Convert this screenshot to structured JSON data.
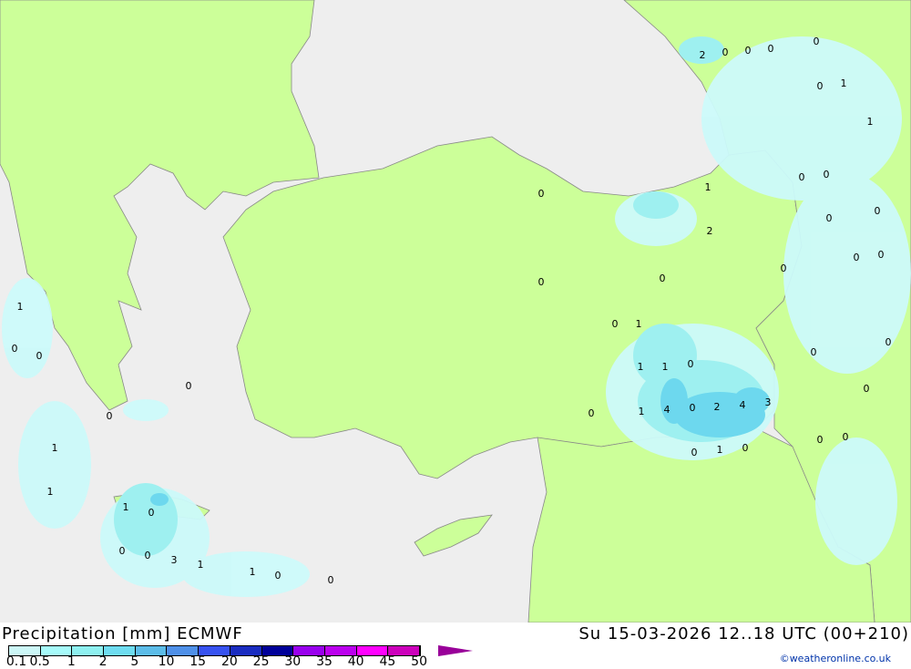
{
  "title": "Precipitation [mm] ECMWF",
  "valid_time": "Su 15-03-2026 12..18 UTC (00+210)",
  "copyright": "©weatheronline.co.uk",
  "colors": {
    "land": "#ccff99",
    "sea": "#eeeeee",
    "border": "#888888",
    "precip_light": "#ccfafa",
    "precip_mid": "#9ef0f0",
    "precip_high": "#6dd8ee"
  },
  "legend": {
    "ticks": [
      "0.1",
      "0.5",
      "1",
      "2",
      "5",
      "10",
      "15",
      "20",
      "25",
      "30",
      "35",
      "40",
      "45",
      "50"
    ],
    "colors": [
      "#ccf7f7",
      "#a6fafa",
      "#8ef0f0",
      "#6edcf0",
      "#5cbce8",
      "#4f90e8",
      "#3752f0",
      "#1a2cc0",
      "#000099",
      "#9900ee",
      "#bb00ee",
      "#ff00ff",
      "#cc00bb"
    ]
  },
  "precip_labels": [
    "2",
    "0",
    "0",
    "0",
    "0",
    "0",
    "1",
    "1",
    "0",
    "0",
    "0",
    "0",
    "1",
    "2",
    "0",
    "0",
    "0",
    "0",
    "0",
    "0",
    "0",
    "0",
    "0",
    "0",
    "0",
    "0",
    "1",
    "1",
    "1",
    "0",
    "0",
    "1",
    "4",
    "0",
    "2",
    "4",
    "3",
    "0",
    "1",
    "0",
    "1",
    "0",
    "0",
    "0",
    "0",
    "1",
    "1",
    "1",
    "0",
    "0",
    "0",
    "3",
    "1",
    "1",
    "0",
    "0"
  ]
}
